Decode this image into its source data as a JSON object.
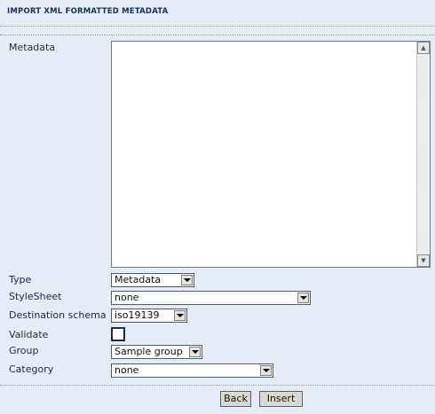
{
  "header": {
    "title": "IMPORT XML FORMATTED METADATA"
  },
  "form": {
    "metadata_label": "Metadata",
    "metadata_value": "",
    "type_label": "Type",
    "type_value": "Metadata",
    "stylesheet_label": "StyleSheet",
    "stylesheet_value": "none",
    "destination_label": "Destination schema",
    "destination_value": "iso19139",
    "validate_label": "Validate",
    "validate_checked": false,
    "group_label": "Group",
    "group_value": "Sample group",
    "category_label": "Category",
    "category_value": "none"
  },
  "buttons": {
    "back": "Back",
    "insert": "Insert"
  },
  "icons": {
    "scroll_up": "scroll-up-arrow-icon",
    "scroll_down": "scroll-down-arrow-icon",
    "dropdown": "chevron-down-icon"
  }
}
